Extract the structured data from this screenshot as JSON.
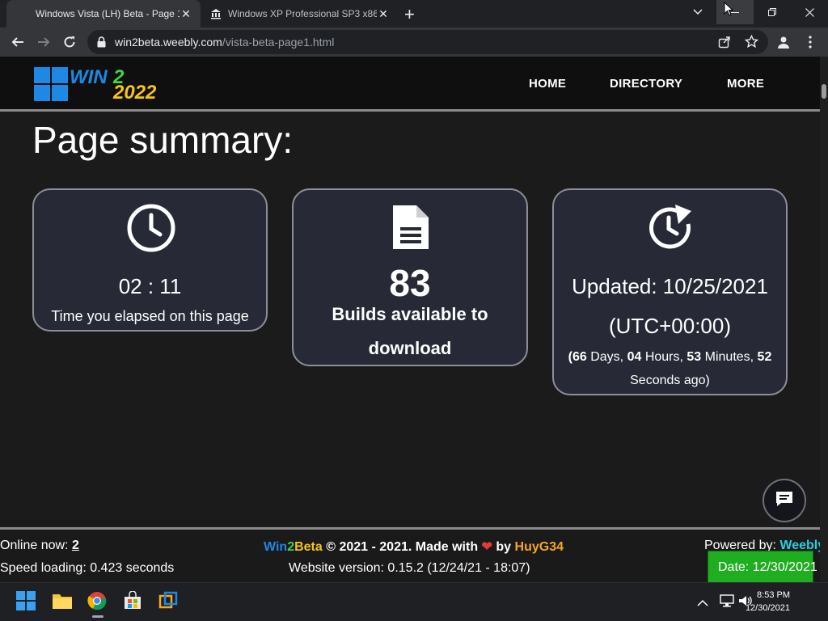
{
  "browser": {
    "tabs": [
      {
        "title": "Windows Vista (LH) Beta - Page 1",
        "close": "✕",
        "active": true
      },
      {
        "title": "Windows XP Professional SP3 x86",
        "close": "✕",
        "active": false
      }
    ],
    "new_tab": "+",
    "url_host": "win2beta.weebly.com",
    "url_path": "/vista-beta-page1.html"
  },
  "site": {
    "logo": {
      "win": "WIN",
      "two": "2",
      "year": "2022"
    },
    "nav": [
      "HOME",
      "DIRECTORY",
      "MORE"
    ],
    "heading": "Page summary:",
    "cards": {
      "time": {
        "value": "02 : 11",
        "label": "Time you elapsed on this page"
      },
      "builds": {
        "value": "83",
        "label_line1": "Builds available to",
        "label_line2": "download"
      },
      "updated": {
        "line1": "Updated: 10/25/2021",
        "line2": "(UTC+00:00)",
        "open_paren": "(",
        "days": "66",
        "days_label": " Days, ",
        "hours": "04",
        "hours_label": " Hours, ",
        "minutes": "53",
        "minutes_label": " Minutes, ",
        "seconds": "52",
        "seconds_label": "Seconds ago)"
      }
    },
    "footer": {
      "online_label": "Online now: ",
      "online_count": "2",
      "brand_win": "Win",
      "brand_2": "2",
      "brand_beta": "Beta",
      "copyright": " © 2021 - 2021. Made with ",
      "by": " by ",
      "author": "HuyG34",
      "powered_label": "Powered by: ",
      "powered_name": "Weebly",
      "speed": "Speed loading: 0.423 seconds",
      "version": "Website version: 0.15.2 (12/24/21 - 18:07)",
      "date_badge": "Date: 12/30/2021"
    }
  },
  "taskbar": {
    "time": "8:53 PM",
    "date": "12/30/2021"
  },
  "colors": {
    "card_bg": "#272a36",
    "accent_blue": "#1e88e5",
    "brand_green": "#3dd64a",
    "brand_yellow": "#f5c518",
    "author_orange": "#f5a623",
    "weebly_cyan": "#26d0e0",
    "date_green": "#1fae1f"
  }
}
